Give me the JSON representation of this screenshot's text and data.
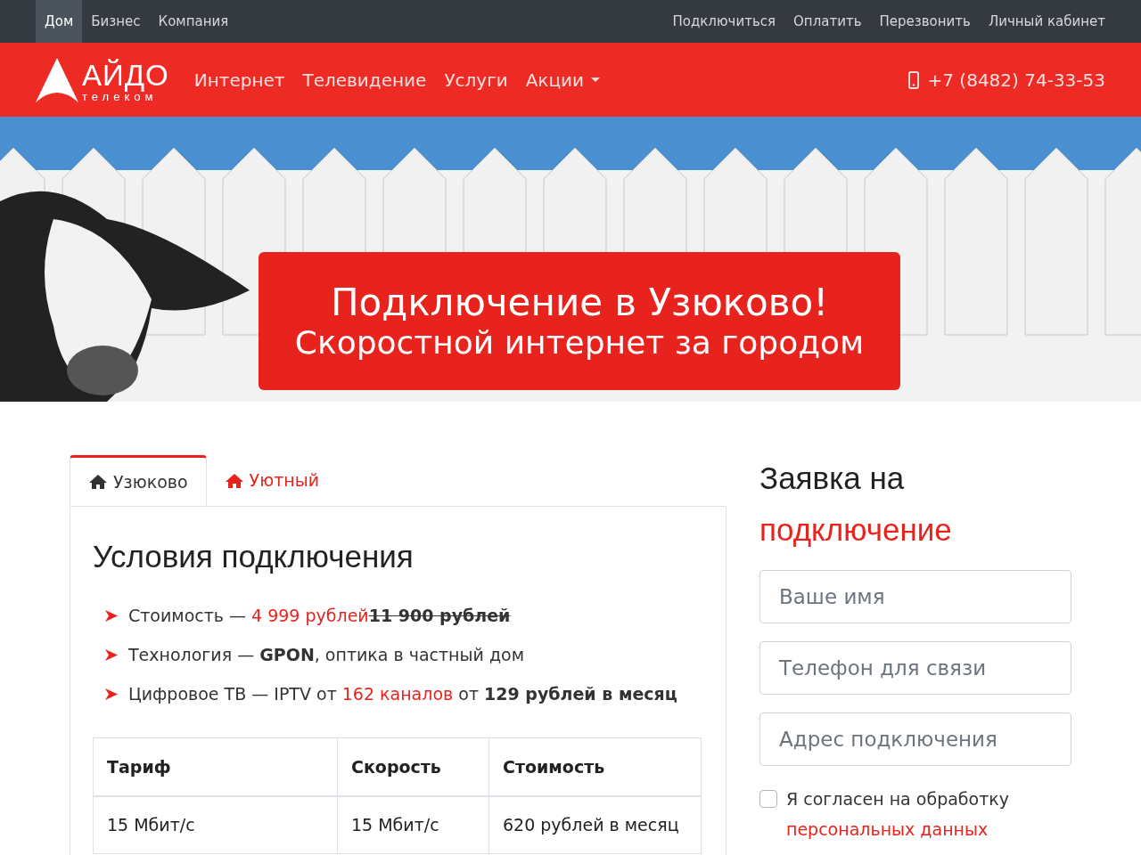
{
  "top_nav": {
    "left": [
      {
        "label": "Дом",
        "selected": true
      },
      {
        "label": "Бизнес",
        "selected": false
      },
      {
        "label": "Компания",
        "selected": false
      }
    ],
    "right": [
      "Подключиться",
      "Оплатить",
      "Перезвонить",
      "Личный кабинет"
    ]
  },
  "header": {
    "logo": {
      "name": "АЙДО",
      "tagline": "телеком"
    },
    "menu": [
      {
        "label": "Интернет",
        "dropdown": false
      },
      {
        "label": "Телевидение",
        "dropdown": false
      },
      {
        "label": "Услуги",
        "dropdown": false
      },
      {
        "label": "Акции",
        "dropdown": true
      }
    ],
    "phone": "+7 (8482) 74-33-53"
  },
  "banner": {
    "title": "Подключение в Узюково!",
    "subtitle": "Скоростной интернет за городом"
  },
  "tabs": [
    {
      "label": "Узюково",
      "selected": true
    },
    {
      "label": "Уютный",
      "selected": false
    }
  ],
  "conditions": {
    "title": "Условия подключения",
    "items": [
      [
        {
          "text": "Стоимость — ",
          "kind": "plain"
        },
        {
          "text": "4 999 рублей",
          "kind": "accent"
        },
        {
          "text": "11 900 рублей",
          "kind": "strike"
        }
      ],
      [
        {
          "text": "Технология — ",
          "kind": "plain"
        },
        {
          "text": "GPON",
          "kind": "bold"
        },
        {
          "text": ", оптика в частный дом",
          "kind": "plain"
        }
      ],
      [
        {
          "text": "Цифровое ТВ — IPTV от ",
          "kind": "plain"
        },
        {
          "text": "162 каналов",
          "kind": "accent"
        },
        {
          "text": " от ",
          "kind": "plain"
        },
        {
          "text": "129 рублей в месяц",
          "kind": "bold"
        }
      ]
    ]
  },
  "table": {
    "columns": [
      "Тариф",
      "Скорость",
      "Стоимость"
    ],
    "rows": [
      [
        "15 Мбит/с",
        "15 Мбит/с",
        "620 рублей в месяц"
      ]
    ]
  },
  "request_form": {
    "title": "Заявка на",
    "title_accent": "подключение",
    "fields": [
      {
        "placeholder": "Ваше имя"
      },
      {
        "placeholder": "Телефон для связи"
      },
      {
        "placeholder": "Адрес подключения"
      }
    ],
    "consent": {
      "checked": false,
      "text": "Я согласен на обработку",
      "link": "персональных данных"
    }
  }
}
